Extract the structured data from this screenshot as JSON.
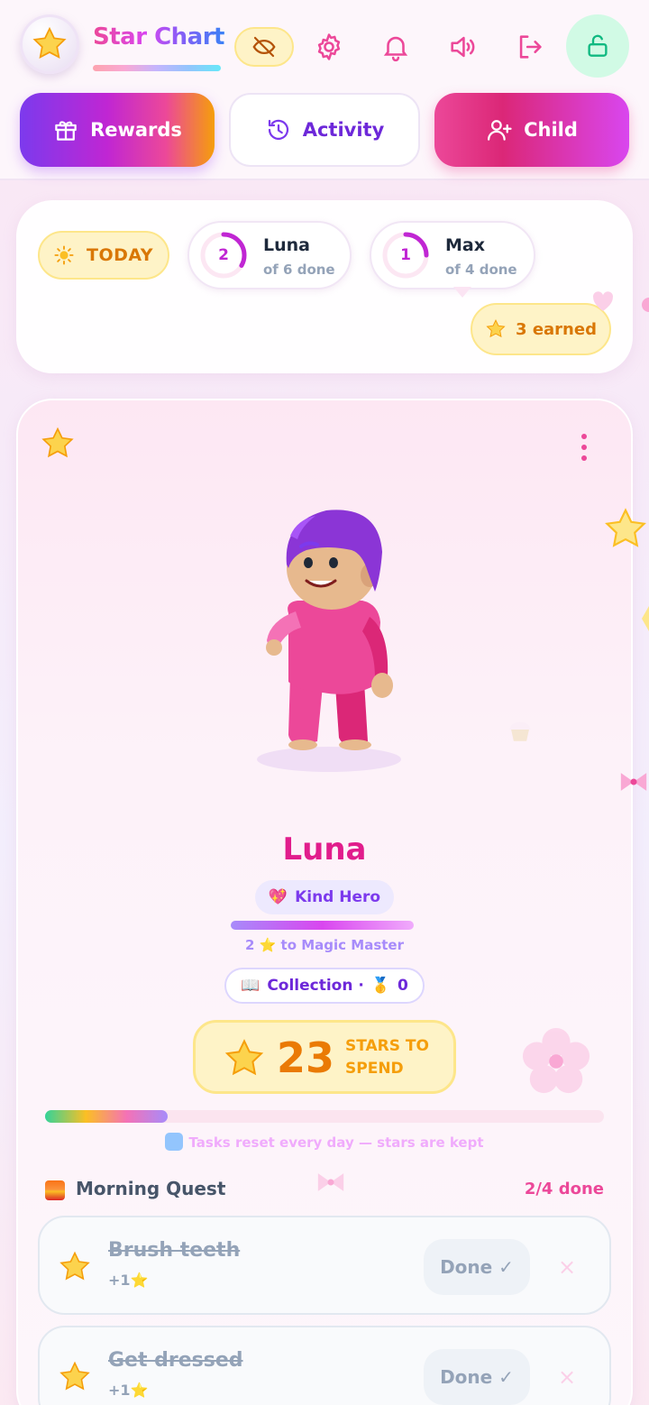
{
  "header": {
    "app_title": "Star Chart",
    "icons": [
      "star-icon",
      "eye-off-icon",
      "gear-icon",
      "bell-icon",
      "volume-icon",
      "logout-icon",
      "unlock-icon"
    ]
  },
  "nav": {
    "rewards_label": "Rewards",
    "activity_label": "Activity",
    "child_label": "Child"
  },
  "summary": {
    "today_label": "TODAY",
    "children": [
      {
        "ring_count": "2",
        "name": "Luna",
        "sub": "of 6 done",
        "progress": 0.333
      },
      {
        "ring_count": "1",
        "name": "Max",
        "sub": "of 4 done",
        "progress": 0.25
      }
    ],
    "earned_label": "3 earned"
  },
  "profile": {
    "name": "Luna",
    "title_emoji": "💖",
    "title": "Kind Hero",
    "level_text": "2 ⭐ to Magic Master",
    "collection_prefix": "📖",
    "collection_label": "Collection ·",
    "collection_medal": "🥇",
    "collection_count": "0",
    "stars_count": "23",
    "stars_label": "STARS TO SPEND",
    "day_progress": 0.22,
    "reset_note": "Tasks reset every day — stars are kept"
  },
  "quest": {
    "title": "Morning Quest",
    "count": "2/4 done",
    "tasks": [
      {
        "name": "Brush teeth",
        "reward": "+1⭐",
        "done_label": "Done ✓",
        "remove": "×"
      },
      {
        "name": "Get dressed",
        "reward": "+1⭐",
        "done_label": "Done ✓",
        "remove": "×"
      }
    ]
  },
  "colors": {
    "accent_pink": "#ec4899",
    "accent_purple": "#7c3aed",
    "star_gold": "#fbbf24"
  }
}
